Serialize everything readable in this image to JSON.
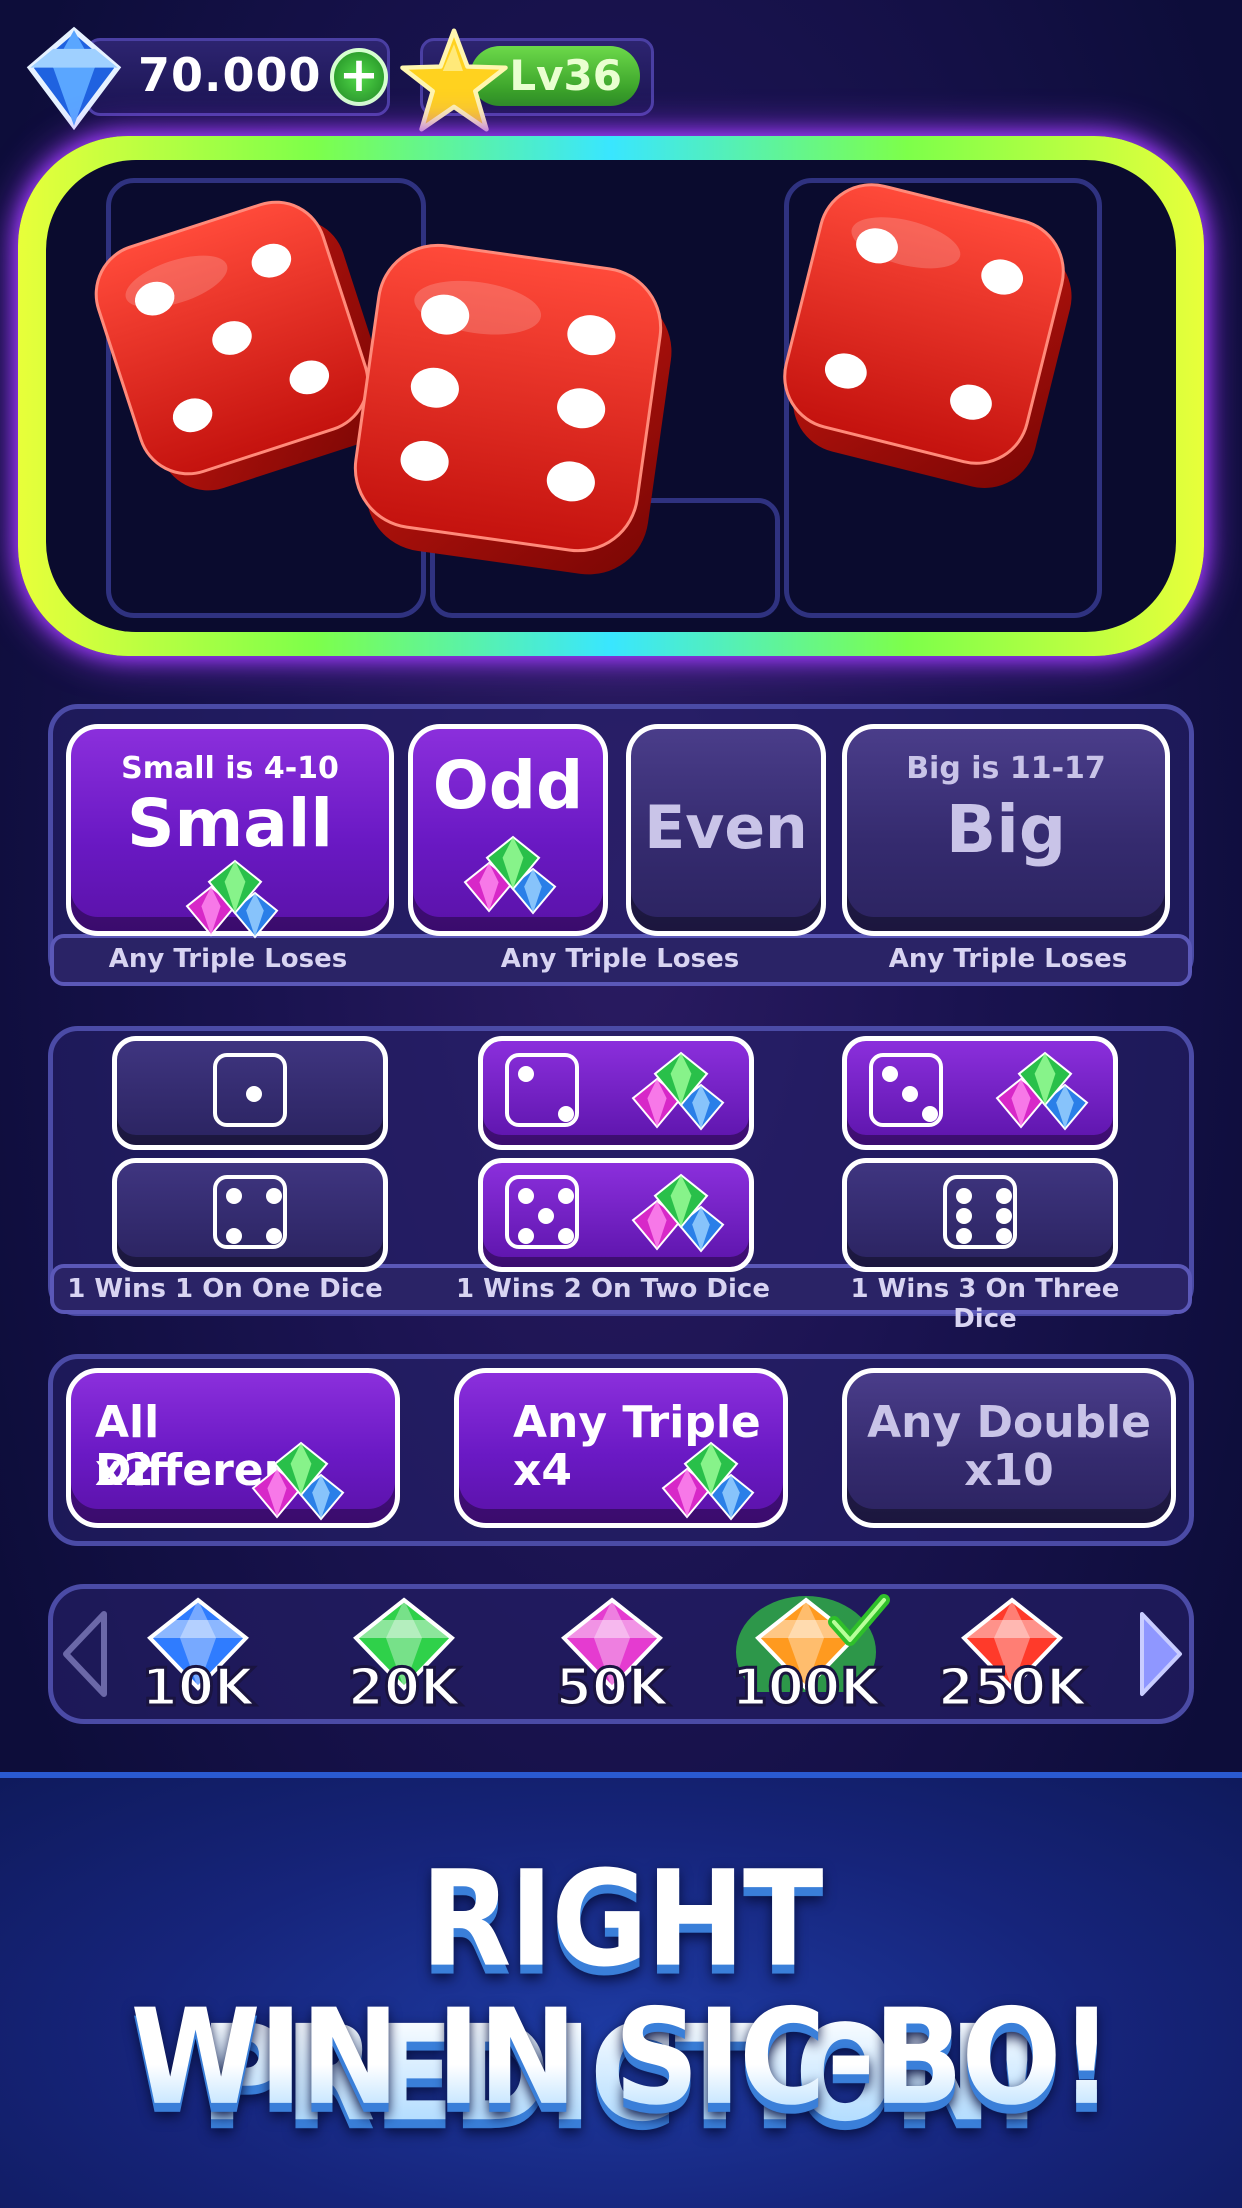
{
  "header": {
    "balance": "70.000",
    "add_symbol": "+",
    "level": "Lv36",
    "colors": {
      "gem": "#3f8cff",
      "plus": "#2fb02f",
      "level_bar": "#4fc23a",
      "star": "#ffd21f"
    }
  },
  "dice_result": {
    "dice": [
      5,
      6,
      4
    ]
  },
  "bets_row1": {
    "small": {
      "hint": "Small is 4-10",
      "label": "Small",
      "caption": "Any Triple Loses",
      "active": true
    },
    "odd": {
      "label": "Odd",
      "active": true
    },
    "odd_even_caption": "Any Triple Loses",
    "even": {
      "label": "Even",
      "active": false
    },
    "big": {
      "hint": "Big is 11-17",
      "label": "Big",
      "caption": "Any Triple Loses",
      "active": false
    }
  },
  "bets_row2": {
    "captions": [
      "1 Wins 1 On One Dice",
      "1 Wins 2 On Two Dice",
      "1 Wins 3 On Three Dice"
    ],
    "faces": [
      {
        "value": 1,
        "active": false
      },
      {
        "value": 2,
        "active": true
      },
      {
        "value": 3,
        "active": true
      },
      {
        "value": 4,
        "active": false
      },
      {
        "value": 5,
        "active": true
      },
      {
        "value": 6,
        "active": false
      }
    ]
  },
  "bets_row3": {
    "all_different": {
      "label": "All Different",
      "mult": "x2",
      "active": true
    },
    "any_triple": {
      "label": "Any Triple",
      "mult": "x4",
      "active": true
    },
    "any_double": {
      "label": "Any Double",
      "mult": "x10",
      "active": false
    }
  },
  "chips": [
    {
      "label": "10K",
      "color": "#2f7cff",
      "selected": false
    },
    {
      "label": "20K",
      "color": "#2fd14a",
      "selected": false
    },
    {
      "label": "50K",
      "color": "#e53bd0",
      "selected": false
    },
    {
      "label": "100K",
      "color": "#ff9a1f",
      "selected": true
    },
    {
      "label": "250K",
      "color": "#ff3a2a",
      "selected": false
    }
  ],
  "banner": {
    "line1": "RIGHT PREDICTION!",
    "line2": "WIN IN SIC-BO!"
  }
}
